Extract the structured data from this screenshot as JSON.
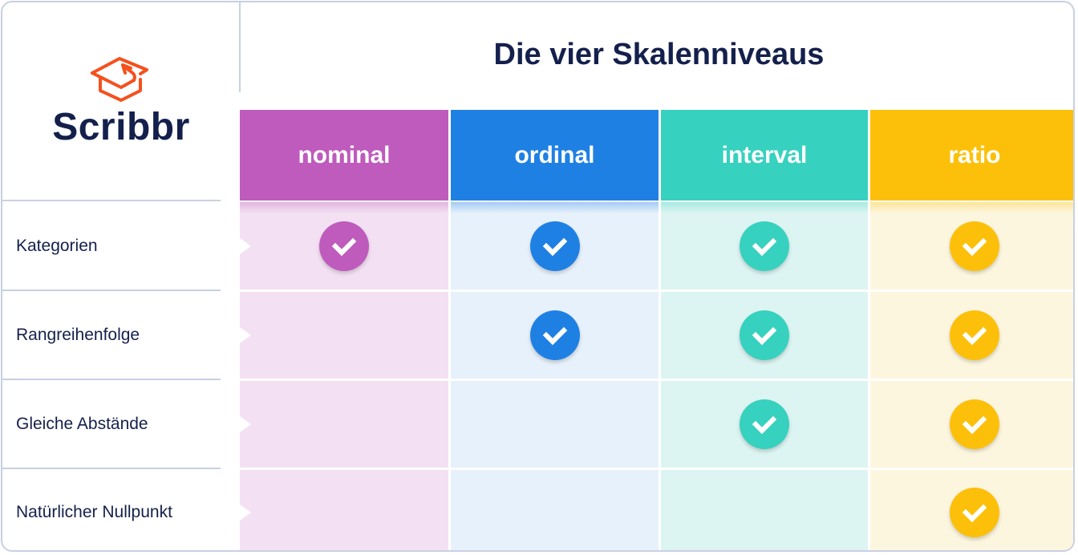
{
  "brand": {
    "name": "Scribbr",
    "icon": "graduation-cap-icon",
    "icon_color": "#f4511e",
    "text_color": "#14204c"
  },
  "title": "Die vier Skalenniveaus",
  "columns": [
    {
      "label": "nominal",
      "color": "#bf5bbd",
      "bg": "#f3e1f3"
    },
    {
      "label": "ordinal",
      "color": "#1f80e4",
      "bg": "#e6f1fb"
    },
    {
      "label": "interval",
      "color": "#37d1bf",
      "bg": "#ddf5f2"
    },
    {
      "label": "ratio",
      "color": "#fdc00a",
      "bg": "#fdf6df"
    }
  ],
  "rows": [
    {
      "label": "Kategorien",
      "checks": [
        true,
        true,
        true,
        true
      ]
    },
    {
      "label": "Rangreihenfolge",
      "checks": [
        false,
        true,
        true,
        true
      ]
    },
    {
      "label": "Gleiche Abstände",
      "checks": [
        false,
        false,
        true,
        true
      ]
    },
    {
      "label": "Natürlicher Nullpunkt",
      "checks": [
        false,
        false,
        false,
        true
      ]
    }
  ],
  "check_icon": "checkmark-circle-icon"
}
